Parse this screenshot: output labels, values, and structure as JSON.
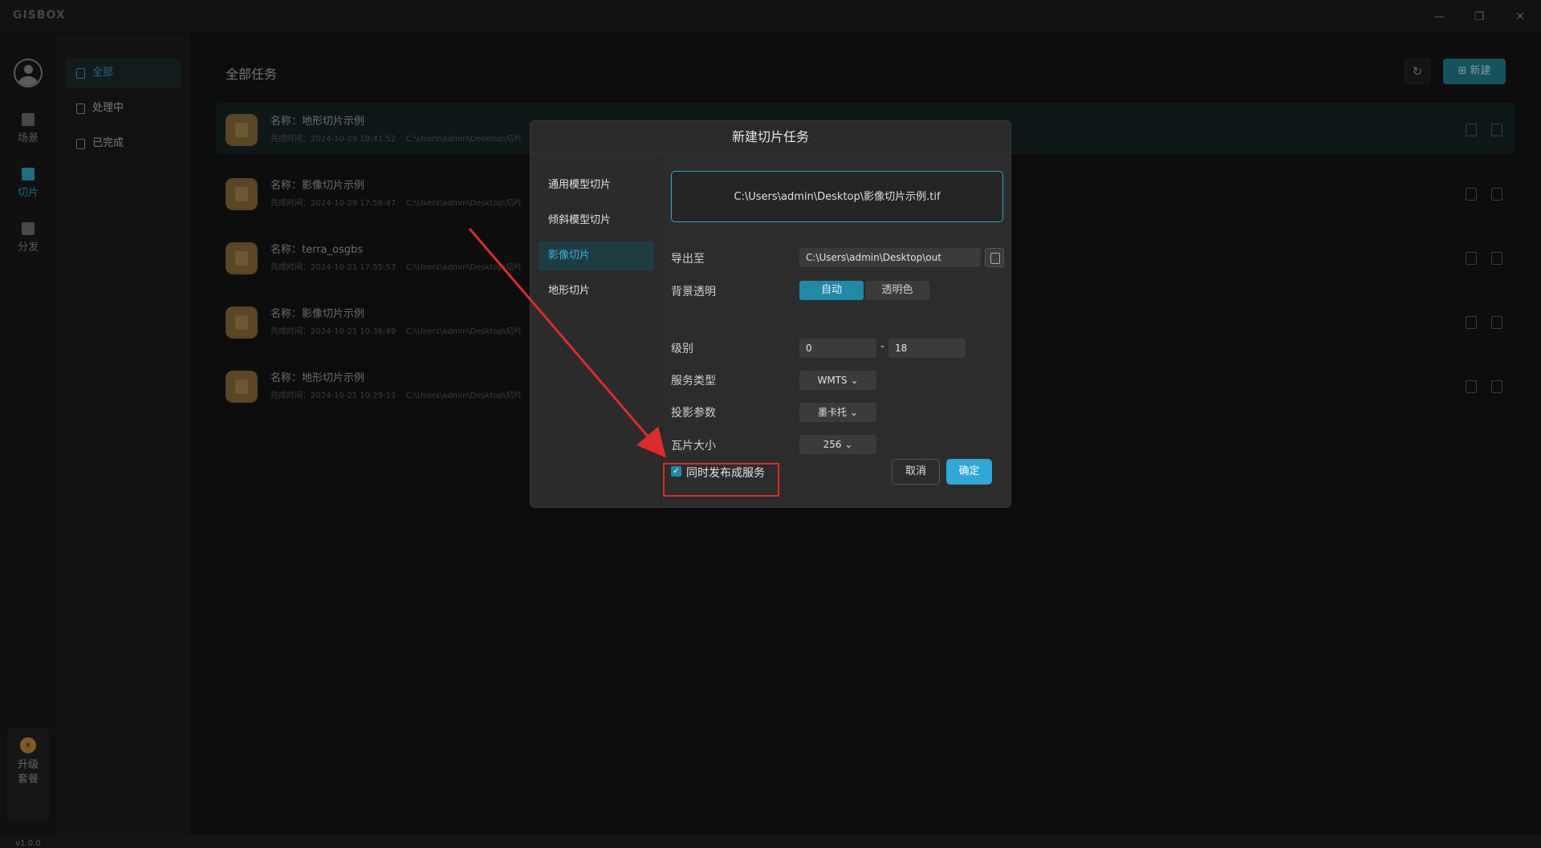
{
  "app": {
    "logo": "GISBOX",
    "version": "v1.0.0"
  },
  "rail": {
    "items": [
      {
        "label": "场景"
      },
      {
        "label": "切片"
      },
      {
        "label": "分发"
      }
    ],
    "upgrade": {
      "line1": "升级",
      "line2": "套餐"
    }
  },
  "subnav": {
    "items": [
      {
        "label": "全部"
      },
      {
        "label": "处理中"
      },
      {
        "label": "已完成"
      }
    ]
  },
  "main": {
    "title": "全部任务",
    "new_button": "新建",
    "tasks": [
      {
        "name": "名称：地形切片示例",
        "time": "完成时间：2024-10-29 18:41:52",
        "path": "C:\\Users\\admin\\Desktop\\切片"
      },
      {
        "name": "名称：影像切片示例",
        "time": "完成时间：2024-10-29 17:56:47",
        "path": "C:\\Users\\admin\\Desktop\\切片"
      },
      {
        "name": "名称：terra_osgbs",
        "time": "完成时间：2024-10-21 17:55:53",
        "path": "C:\\Users\\admin\\Desktop\\切片"
      },
      {
        "name": "名称：影像切片示例",
        "time": "完成时间：2024-10-21 10:36:49",
        "path": "C:\\Users\\admin\\Desktop\\切片"
      },
      {
        "name": "名称：地形切片示例",
        "time": "完成时间：2024-10-21 10:29:13",
        "path": "C:\\Users\\admin\\Desktop\\切片"
      }
    ]
  },
  "dialog": {
    "title": "新建切片任务",
    "tabs": [
      {
        "label": "通用模型切片"
      },
      {
        "label": "倾斜模型切片"
      },
      {
        "label": "影像切片"
      },
      {
        "label": "地形切片"
      }
    ],
    "file_path": "C:\\Users\\admin\\Desktop\\影像切片示例.tif",
    "export_label": "导出至",
    "export_value": "C:\\Users\\admin\\Desktop\\out",
    "bg_label": "背景透明",
    "bg_options": [
      "自动",
      "透明色"
    ],
    "level_label": "级别",
    "level_min": "0",
    "level_sep": "-",
    "level_max": "18",
    "service_label": "服务类型",
    "service_value": "WMTS",
    "proj_label": "投影参数",
    "proj_value": "墨卡托",
    "tile_label": "瓦片大小",
    "tile_value": "256",
    "publish_label": "同时发布成服务",
    "cancel": "取消",
    "ok": "确定"
  },
  "colors": {
    "accent": "#2fa8c9",
    "annotation": "#e02b2b"
  }
}
